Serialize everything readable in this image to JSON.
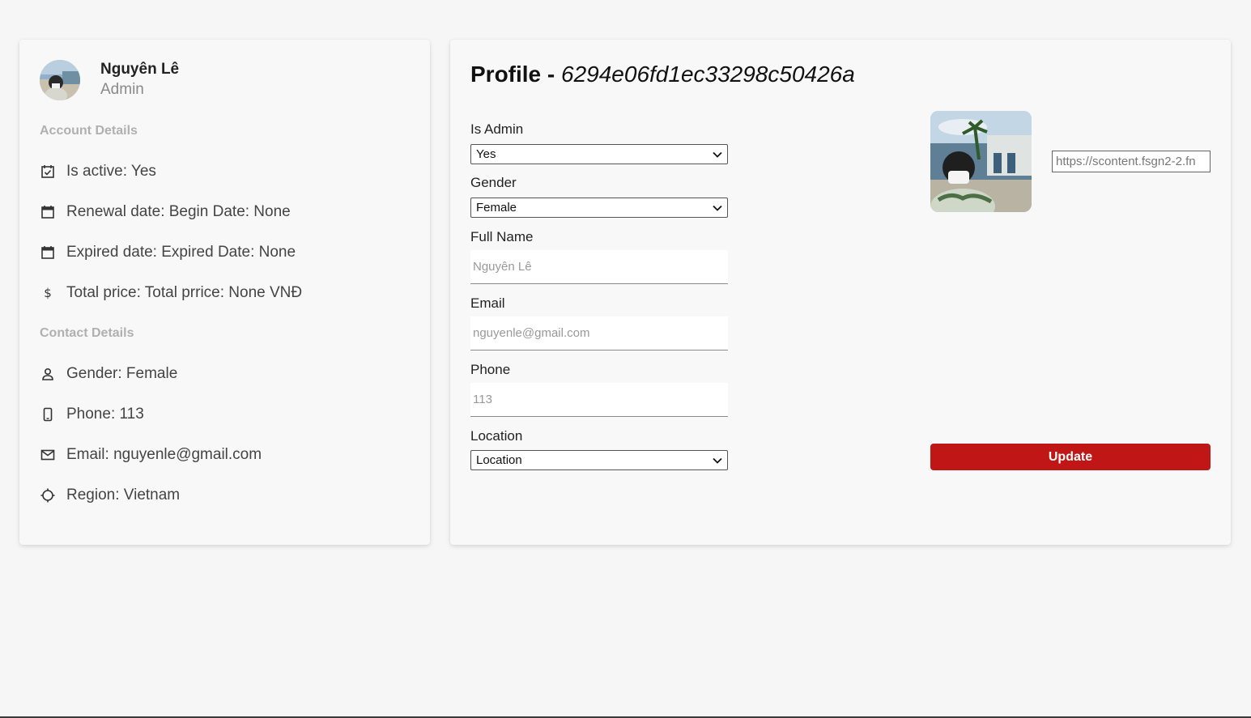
{
  "user": {
    "name": "Nguyên Lê",
    "role": "Admin"
  },
  "account_details": {
    "title": "Account Details",
    "items": [
      {
        "icon": "calendar-check-icon",
        "text": "Is active: Yes"
      },
      {
        "icon": "calendar-icon",
        "text": "Renewal date: Begin Date: None"
      },
      {
        "icon": "calendar-icon",
        "text": "Expired date: Expired Date: None"
      },
      {
        "icon": "dollar-icon",
        "text": "Total price: Total prrice: None VNĐ"
      }
    ]
  },
  "contact_details": {
    "title": "Contact Details",
    "items": [
      {
        "icon": "person-icon",
        "text": "Gender: Female"
      },
      {
        "icon": "phone-icon",
        "text": "Phone: 113"
      },
      {
        "icon": "mail-icon",
        "text": "Email: nguyenle@gmail.com"
      },
      {
        "icon": "crosshair-icon",
        "text": "Region: Vietnam"
      }
    ]
  },
  "profile": {
    "title_prefix": "Profile - ",
    "id": "6294e06fd1ec33298c50426a"
  },
  "form": {
    "is_admin": {
      "label": "Is Admin",
      "value": "Yes"
    },
    "gender": {
      "label": "Gender",
      "value": "Female"
    },
    "full_name": {
      "label": "Full Name",
      "placeholder": "Nguyên Lê"
    },
    "email": {
      "label": "Email",
      "placeholder": "nguyenle@gmail.com"
    },
    "phone": {
      "label": "Phone",
      "placeholder": "113"
    },
    "location": {
      "label": "Location",
      "value": "Location"
    },
    "avatar_url": "https://scontent.fsgn2-2.fn",
    "update_label": "Update"
  },
  "colors": {
    "accent": "#c01616",
    "background": "#f6f6f6"
  }
}
